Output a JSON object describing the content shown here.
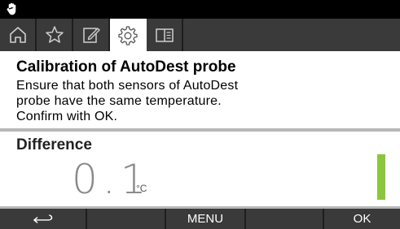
{
  "status_bar": {
    "icon": "hand-icon"
  },
  "tabs": [
    {
      "icon": "home-icon",
      "active": false
    },
    {
      "icon": "star-icon",
      "active": false
    },
    {
      "icon": "edit-icon",
      "active": false
    },
    {
      "icon": "gear-icon",
      "active": true
    },
    {
      "icon": "manual-icon",
      "active": false
    }
  ],
  "calibration": {
    "title": "Calibration of AutoDest probe",
    "instruction_line_1": "Ensure that both sensors of AutoDest",
    "instruction_line_2": "probe have the same temperature.",
    "instruction_line_3": "Confirm with OK."
  },
  "difference": {
    "label": "Difference",
    "value": "0.1",
    "unit": "°C"
  },
  "softkeys": [
    {
      "icon": "back-arrow-icon",
      "label": ""
    },
    {
      "label": ""
    },
    {
      "label": "MENU"
    },
    {
      "label": ""
    },
    {
      "label": "OK"
    }
  ],
  "colors": {
    "status_bar": "#000000",
    "tab_bar": "#3a3a3a",
    "value_text": "#8a8a8a",
    "indicator_bar": "#8cc63f",
    "divider": "#b8b8b8"
  }
}
